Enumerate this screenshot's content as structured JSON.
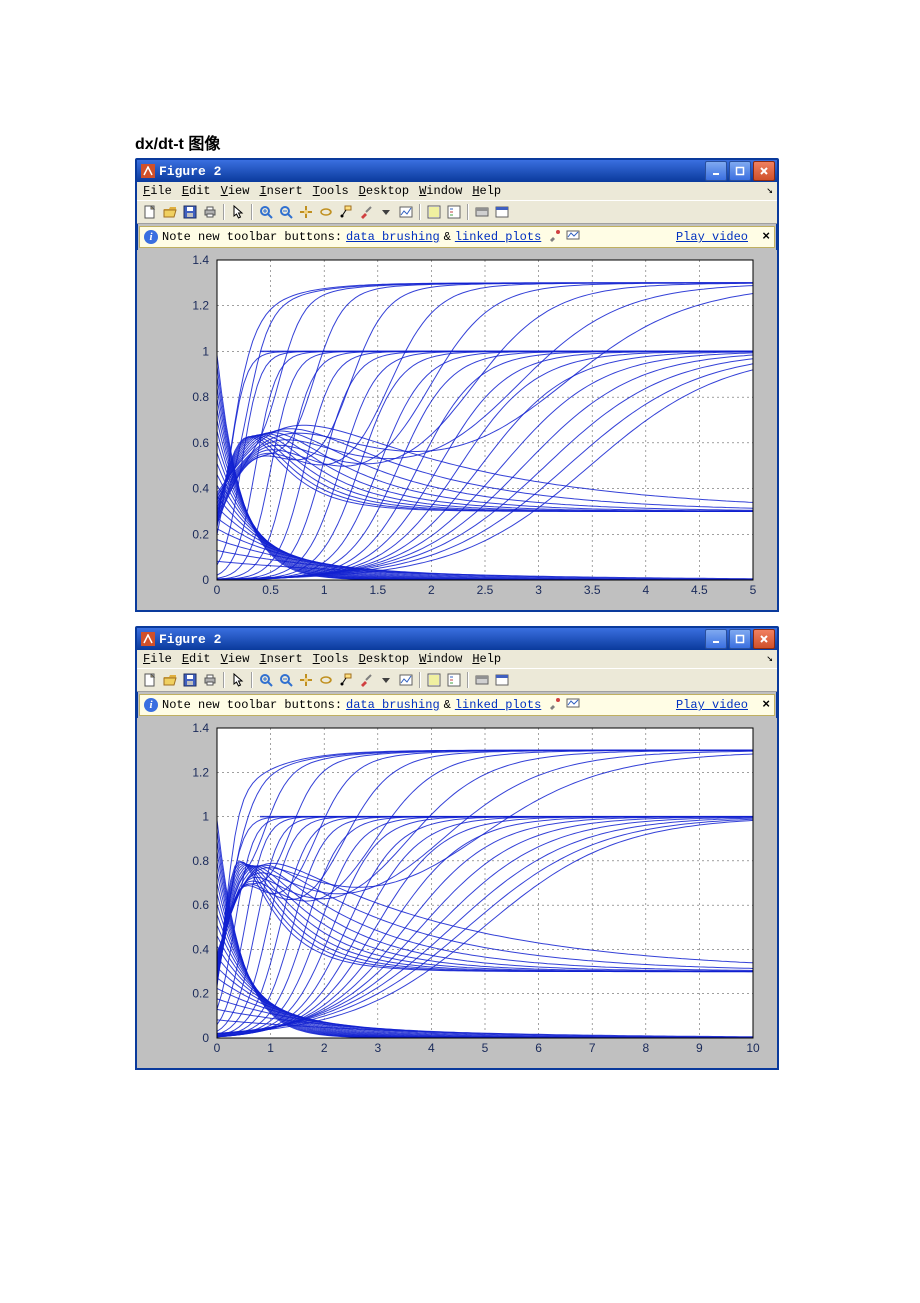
{
  "caption": "dx/dt-t 图像",
  "windows": [
    {
      "title": "Figure 2"
    },
    {
      "title": "Figure 2"
    }
  ],
  "menu": [
    "File",
    "Edit",
    "View",
    "Insert",
    "Tools",
    "Desktop",
    "Window",
    "Help"
  ],
  "toolbar_icons": [
    "new-file-icon",
    "open-file-icon",
    "save-icon",
    "print-icon",
    "sep",
    "pointer-icon",
    "sep",
    "zoom-in-icon",
    "zoom-out-icon",
    "pan-icon",
    "rotate3d-icon",
    "data-cursor-icon",
    "brush-icon",
    "dropdown-icon",
    "link-plot-icon",
    "sep",
    "colorbar-icon",
    "legend-icon",
    "sep",
    "hide-tools-icon",
    "dock-icon"
  ],
  "infobar": {
    "prefix": "Note new toolbar buttons: ",
    "link1": "data brushing",
    "amp": "&",
    "link2": "linked plots",
    "play": "Play video"
  },
  "win_buttons": {
    "min": "_",
    "max": "□",
    "close": "✕"
  },
  "chart_data": [
    {
      "type": "line",
      "title": "",
      "xlabel": "",
      "ylabel": "",
      "xlim": [
        0,
        5
      ],
      "ylim": [
        0,
        1.4
      ],
      "xticks": [
        0,
        0.5,
        1,
        1.5,
        2,
        2.5,
        3,
        3.5,
        4,
        4.5,
        5
      ],
      "yticks": [
        0,
        0.2,
        0.4,
        0.6,
        0.8,
        1,
        1.2,
        1.4
      ],
      "grid": true,
      "description": "Many overlaid trajectories starting near x≈0 at t=0, rising / crossing and converging to y≈1 (top envelope) while a subset of curves decay monotonically toward y≈0 as t→5.",
      "envelope_top_y": 1.0,
      "envelope_bottom_y": 0.02,
      "n_curves_approx": 60
    },
    {
      "type": "line",
      "title": "",
      "xlabel": "",
      "ylabel": "",
      "xlim": [
        0,
        10
      ],
      "ylim": [
        0,
        1.4
      ],
      "xticks": [
        0,
        1,
        2,
        3,
        4,
        5,
        6,
        7,
        8,
        9,
        10
      ],
      "yticks": [
        0,
        0.2,
        0.4,
        0.6,
        0.8,
        1,
        1.2,
        1.4
      ],
      "grid": true,
      "description": "Family of curves densely packed near t∈[0,2]; top envelope quickly saturates at y≈1 and stays flat to t=10; lower curves decay to y≈0.",
      "envelope_top_y": 1.0,
      "envelope_bottom_y": 0.01,
      "n_curves_approx": 60
    }
  ]
}
